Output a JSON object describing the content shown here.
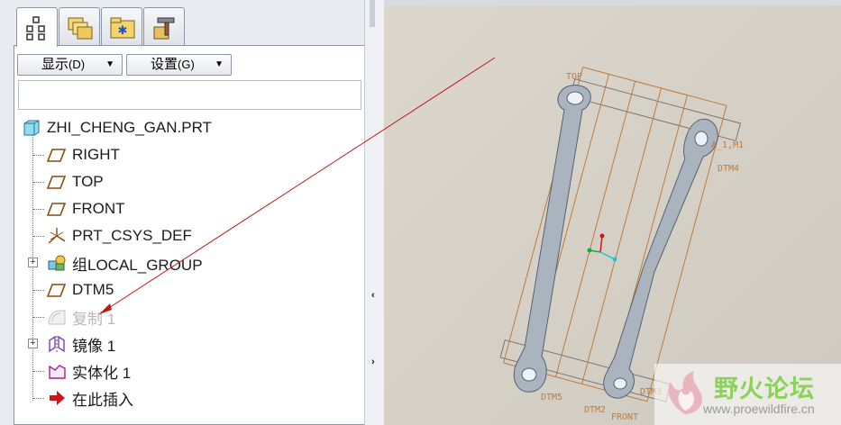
{
  "tabs": [
    {
      "name": "model-tree-icon"
    },
    {
      "name": "folder-browser-icon"
    },
    {
      "name": "favorites-icon"
    },
    {
      "name": "connections-icon"
    }
  ],
  "toolbar": {
    "display_label": "显示",
    "display_shortcut": "(D)",
    "settings_label": "设置",
    "settings_shortcut": "(G)"
  },
  "tree": {
    "root": "ZHI_CHENG_GAN.PRT",
    "items": [
      {
        "label": "RIGHT",
        "icon": "datum-plane-icon"
      },
      {
        "label": "TOP",
        "icon": "datum-plane-icon"
      },
      {
        "label": "FRONT",
        "icon": "datum-plane-icon"
      },
      {
        "label": "PRT_CSYS_DEF",
        "icon": "coordinate-system-icon"
      },
      {
        "label": "组LOCAL_GROUP",
        "icon": "group-icon"
      },
      {
        "label": "DTM5",
        "icon": "datum-plane-icon"
      },
      {
        "label": "复制 1",
        "icon": "copy-feature-icon"
      },
      {
        "label": "镜像 1",
        "icon": "mirror-icon"
      },
      {
        "label": "实体化 1",
        "icon": "solidify-icon"
      },
      {
        "label": "在此插入",
        "icon": "insert-here-arrow-icon"
      }
    ]
  },
  "graphics_labels": {
    "top": "TOP",
    "dtm1": "A_1,M1",
    "dtm4": "DTM4",
    "dtm5": "DTM5",
    "dtm2": "DTM2",
    "front": "FRONT",
    "dtm3": "DTM3"
  },
  "watermark": {
    "title": "野火论坛",
    "url": "www.proewildfire.cn"
  },
  "colors": {
    "datum": "#c07a3a",
    "part": "#a9b4bf",
    "annotation_arrow": "#c01818"
  }
}
